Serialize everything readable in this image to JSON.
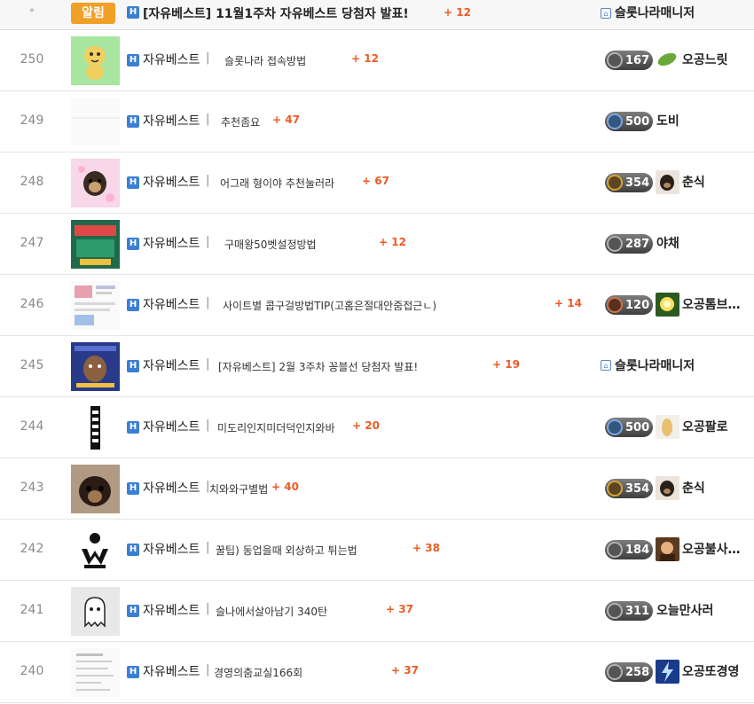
{
  "board": {
    "notice": {
      "num": "*",
      "badge": "알림",
      "icon": "H",
      "title": "[자유베스트] 11월1주차 자유베스트 당첨자 발표!",
      "comment_count": "+ 12",
      "author": "슬롯나라매니저"
    },
    "posts": [
      {
        "num": "250",
        "icon": "H",
        "category": "자유베스트",
        "separator": "|",
        "title": "슬롯나라 접속방법",
        "comment_count": "+ 12",
        "level": "167",
        "author": "오공느릿"
      },
      {
        "num": "249",
        "icon": "H",
        "category": "자유베스트",
        "separator": "|",
        "title": "추천좀요",
        "comment_count": "+ 47",
        "level": "500",
        "author": "도비"
      },
      {
        "num": "248",
        "icon": "H",
        "category": "자유베스트",
        "separator": "|",
        "title": "어그래 형이야 추천눌러라",
        "comment_count": "+ 67",
        "level": "354",
        "author": "춘식"
      },
      {
        "num": "247",
        "icon": "H",
        "category": "자유베스트",
        "separator": "|",
        "title": "구매왕50벳설정방법",
        "comment_count": "+ 12",
        "level": "287",
        "author": "야채"
      },
      {
        "num": "246",
        "icon": "H",
        "category": "자유베스트",
        "separator": "|",
        "title": "사이트별 콥구걸방법TIP(고홈은절대안줌접근ㄴ)",
        "comment_count": "+ 14",
        "level": "120",
        "author": "오공톰브…"
      },
      {
        "num": "245",
        "icon": "H",
        "category": "자유베스트",
        "separator": "|",
        "title": "[자유베스트] 2월 3주차 꽁블선 당첨자 발표!",
        "comment_count": "+ 19",
        "level": "",
        "author": "슬롯나라매니저"
      },
      {
        "num": "244",
        "icon": "H",
        "category": "자유베스트",
        "separator": "|",
        "title": "미도리인지미더덕인지와바",
        "comment_count": "+ 20",
        "level": "500",
        "author": "오공팔로"
      },
      {
        "num": "243",
        "icon": "H",
        "category": "자유베스트",
        "separator": "|",
        "title": "치와와구별법",
        "comment_count": "+ 40",
        "level": "354",
        "author": "춘식"
      },
      {
        "num": "242",
        "icon": "H",
        "category": "자유베스트",
        "separator": "|",
        "title": "꿀팁) 동업을때 외상하고 튀는법",
        "comment_count": "+ 38",
        "level": "184",
        "author": "오공불사…"
      },
      {
        "num": "241",
        "icon": "H",
        "category": "자유베스트",
        "separator": "|",
        "title": "슬나에서살아남기 340탄",
        "comment_count": "+ 37",
        "level": "311",
        "author": "오늘만사러"
      },
      {
        "num": "240",
        "icon": "H",
        "category": "자유베스트",
        "separator": "|",
        "title": "경영의춤교실166회",
        "comment_count": "+ 37",
        "level": "258",
        "author": "오공또경영"
      }
    ]
  },
  "colors": {
    "accent_orange": "#ee5a24",
    "notice_badge": "#f0a028",
    "category_icon": "#3b7fd4",
    "gem_blue": "#7aa6e0",
    "gem_gold": "#d4a23a",
    "gem_gray": "#b0b0b0",
    "gem_bronze": "#c9754a"
  }
}
